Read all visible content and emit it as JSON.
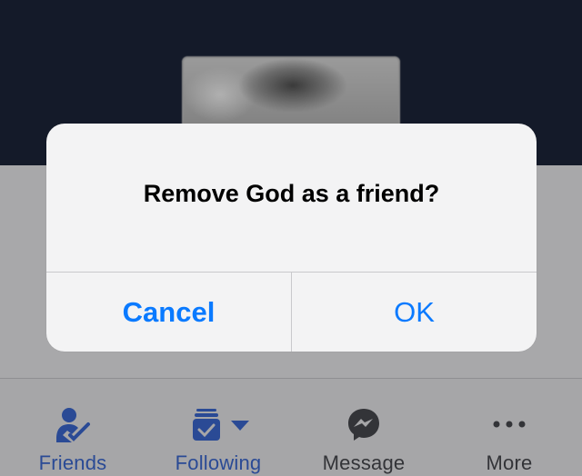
{
  "dialog": {
    "title": "Remove God as a friend?",
    "cancel_label": "Cancel",
    "ok_label": "OK"
  },
  "actions": [
    {
      "label": "Friends",
      "icon": "friends-check-icon",
      "color": "#2a4a95"
    },
    {
      "label": "Following",
      "icon": "following-feed-icon",
      "color": "#2a4a95"
    },
    {
      "label": "Message",
      "icon": "messenger-icon",
      "color": "#333438"
    },
    {
      "label": "More",
      "icon": "more-dots-icon",
      "color": "#333438"
    }
  ],
  "colors": {
    "accent": "#0a7aff",
    "cover": "#141a29",
    "dim": "#a6a6a8",
    "action_blue": "#2a4a95"
  }
}
